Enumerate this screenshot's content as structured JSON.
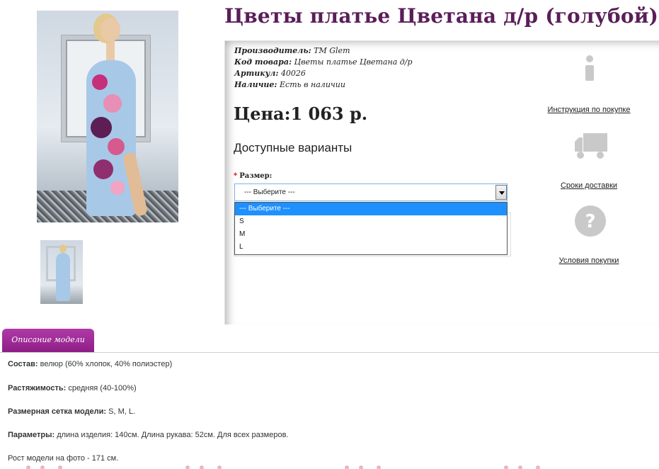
{
  "product": {
    "title": "Цветы платье Цветана д/р (голубой)",
    "meta": [
      {
        "label": "Производитель:",
        "value": "TM Glem"
      },
      {
        "label": "Код товара:",
        "value": "Цветы платье Цветана д/р"
      },
      {
        "label": "Артикул:",
        "value": "40026"
      },
      {
        "label": "Наличие:",
        "value": "Есть в наличии"
      }
    ],
    "price": "Цена:1 063 р.",
    "variants_heading": "Доступные варианты",
    "size_required_mark": "*",
    "size_label": "Размер:",
    "size_select_value": "--- Выберите ---",
    "size_options": [
      "--- Выберите ---",
      "S",
      "M",
      "L"
    ]
  },
  "services": [
    {
      "label": "Инструкция по покупке",
      "icon": "info-icon"
    },
    {
      "label": "Сроки доставки",
      "icon": "truck-icon"
    },
    {
      "label": "Условия покупки",
      "icon": "question-icon"
    }
  ],
  "tabs": [
    {
      "label": "Описание модели"
    }
  ],
  "description": [
    {
      "label": "Состав:",
      "value": " велюр (60% хлопок, 40% полиэстер)"
    },
    {
      "label": "Растяжимость:",
      "value": " средняя (40-100%)"
    },
    {
      "label": "Размерная сетка модели:",
      "value": " S, M, L."
    },
    {
      "label": "Параметры:",
      "value": " длина изделия: 140см. Длина рукава: 52см. Для всех размеров."
    },
    {
      "label": "",
      "value": "Рост модели на фото - 171 см."
    }
  ],
  "colors": {
    "title": "#5a1e58",
    "tab": "#9b2a92",
    "select_highlight": "#1e90ff"
  }
}
